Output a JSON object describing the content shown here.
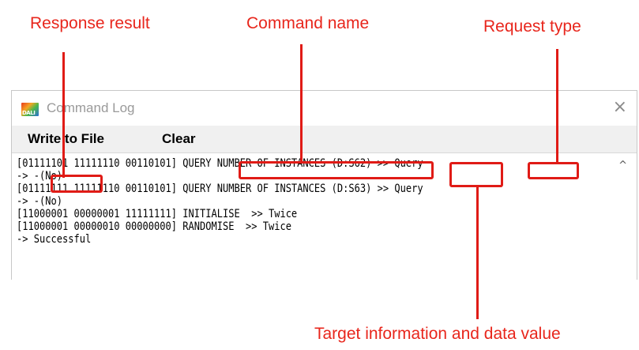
{
  "callouts": {
    "response_result": "Response result",
    "command_name": "Command name",
    "request_type": "Request type",
    "target_info": "Target information and data value"
  },
  "window": {
    "logo_text": "DALI",
    "title": "Command Log",
    "close_glyph": "×"
  },
  "toolbar": {
    "write_to_file": "Write to File",
    "clear": "Clear"
  },
  "log": {
    "lines": [
      "[01111101 11111110 00110101] QUERY NUMBER OF INSTANCES (D:S62) >> Query",
      "-> -(No)",
      "[01111111 11111110 00110101] QUERY NUMBER OF INSTANCES (D:S63) >> Query",
      "-> -(No)",
      "[11000001 00000001 11111111] INITIALISE  >> Twice",
      "[11000001 00000010 00000000] RANDOMISE  >> Twice",
      "-> Successful"
    ],
    "scroll_up_glyph": "^"
  },
  "colors": {
    "callout": "#e8261c",
    "highlight": "#e01b16"
  }
}
